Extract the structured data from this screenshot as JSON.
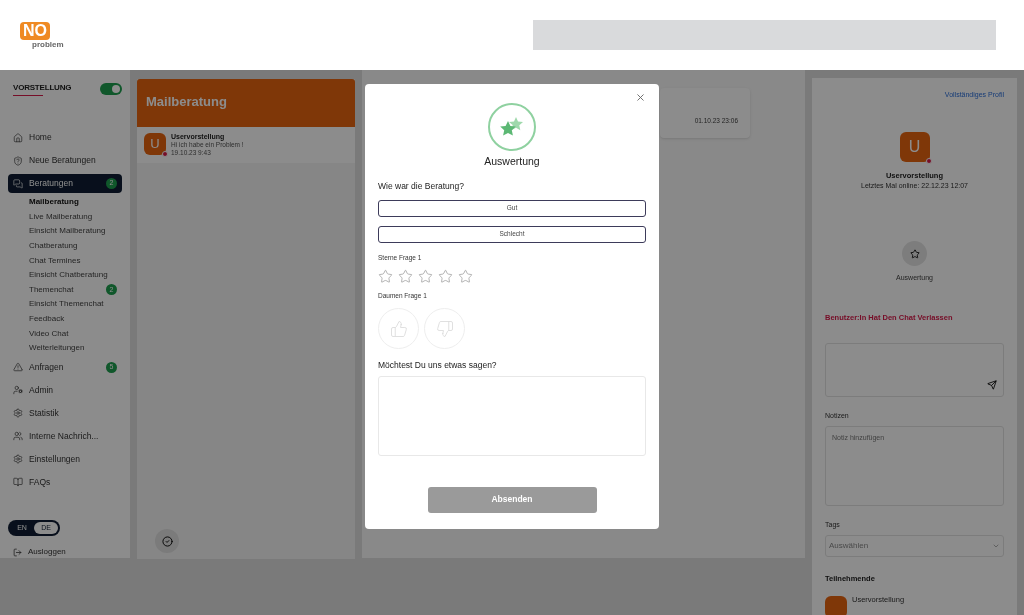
{
  "header": {
    "logo": {
      "mark": "NO",
      "word": "problem"
    }
  },
  "sidebar": {
    "brand": "VORSTELLUNG",
    "online_toggle": {
      "on": true
    },
    "items": [
      {
        "label": "Home",
        "selected": false
      },
      {
        "label": "Neue Beratungen",
        "selected": false
      },
      {
        "label": "Beratungen",
        "selected": true,
        "badge": "2",
        "children": [
          {
            "label": "Mailberatung",
            "selected": true
          },
          {
            "label": "Live Mailberatung",
            "selected": false
          },
          {
            "label": "Einsicht Mailberatung",
            "selected": false
          },
          {
            "label": "Chatberatung",
            "selected": false
          },
          {
            "label": "Chat Termines",
            "selected": false
          },
          {
            "label": "Einsicht Chatberatung",
            "selected": false
          },
          {
            "label": "Themenchat",
            "selected": false,
            "badge": "2"
          },
          {
            "label": "Einsicht Themenchat",
            "selected": false
          },
          {
            "label": "Feedback",
            "selected": false
          },
          {
            "label": "Video Chat",
            "selected": false
          },
          {
            "label": "Weiterleitungen",
            "selected": false
          }
        ]
      },
      {
        "label": "Anfragen",
        "selected": false,
        "badge": "5"
      },
      {
        "label": "Admin",
        "selected": false
      },
      {
        "label": "Statistik",
        "selected": false
      },
      {
        "label": "Interne Nachrich...",
        "selected": false
      },
      {
        "label": "Einstellungen",
        "selected": false
      },
      {
        "label": "FAQs",
        "selected": false
      }
    ],
    "language": [
      {
        "label": "EN",
        "selected": false
      },
      {
        "label": "DE",
        "selected": true
      }
    ],
    "logout": "Ausloggen"
  },
  "inbox": {
    "title": "Mailberatung",
    "threads": [
      {
        "avatar": "U",
        "name": "Uservorstellung",
        "preview": "Hi ich habe ein Problem !",
        "time": "19.10.23 9:43"
      }
    ]
  },
  "message_card": {
    "time": "01.10.23 23:06"
  },
  "profile": {
    "link": "Vollständiges Profil",
    "avatar": "U",
    "name": "Uservorstellung",
    "last_online": "Letztes Mal online: 22.12.23 12:07",
    "action": "Auswertung",
    "status": "Benutzer:In Hat Den Chat Verlassen",
    "notes_label": "Notizen",
    "notes_placeholder": "Notiz hinzufügen",
    "tags_label": "Tags",
    "tags_placeholder": "Auswählen",
    "participants_label": "Teilnehmende",
    "participants": [
      {
        "name": "Uservorstellung"
      }
    ]
  },
  "dialog": {
    "title": "Auswertung",
    "question": "Wie war die Beratung?",
    "options": [
      {
        "label": "Gut",
        "selected": false
      },
      {
        "label": "Schlecht",
        "selected": false
      }
    ],
    "stars_label": "Sterne Frage 1",
    "stars": 0,
    "thumbs_label": "Daumen Frage 1",
    "thumbs": [
      {
        "selected": false
      },
      {
        "selected": false
      }
    ],
    "comment_label": "Möchtest Du uns etwas sagen?",
    "submit": {
      "label": "Absenden",
      "disabled": true
    }
  }
}
